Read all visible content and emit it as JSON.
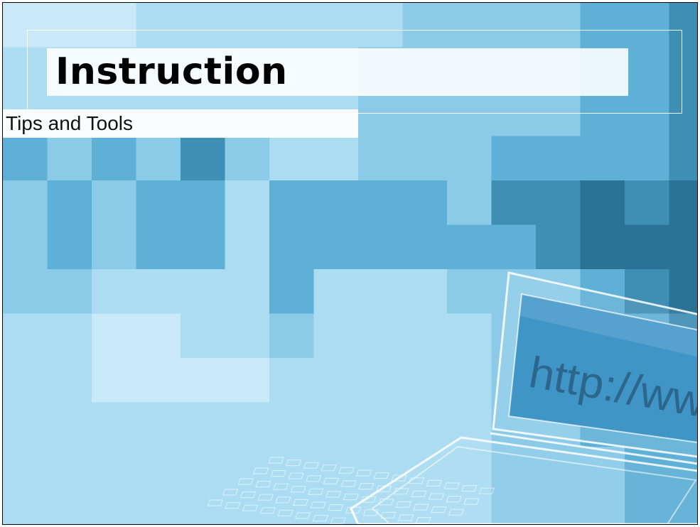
{
  "slide": {
    "title": "Instruction",
    "subtitle": "Tips and Tools"
  },
  "illustration": {
    "screen_text": "http://ww",
    "icon": "laptop-icon"
  },
  "colors": {
    "background": "#a8d8ef",
    "band": "#ffffff",
    "tile_palette": [
      "#5ab4d6",
      "#3f8fb5",
      "#7ec4e2",
      "#9fd3ec",
      "#bfe4f6",
      "#2d6f91"
    ]
  }
}
